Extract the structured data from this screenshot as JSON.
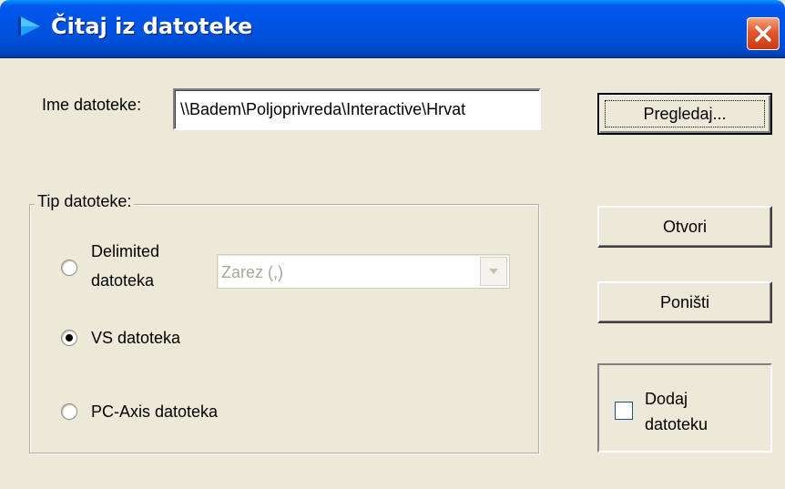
{
  "window": {
    "title": "Čitaj iz datoteke",
    "icon": "blue-pennant-icon",
    "close_icon": "close-icon"
  },
  "file_name": {
    "label": "Ime datoteke:",
    "value": "\\\\Badem\\Poljoprivreda\\Interactive\\Hrvat"
  },
  "buttons": {
    "browse": "Pregledaj...",
    "open": "Otvori",
    "cancel": "Poništi"
  },
  "file_type": {
    "group_title": "Tip datoteke:",
    "options": [
      {
        "label_line1": "Delimited",
        "label_line2": "datoteka",
        "checked": false
      },
      {
        "label": "VS datoteka",
        "checked": true
      },
      {
        "label": "PC-Axis datoteka",
        "checked": false
      }
    ],
    "delimiter_select": {
      "value": "Zarez (,)",
      "enabled": false
    }
  },
  "append": {
    "label_line1": "Dodaj",
    "label_line2": "datoteku",
    "checked": false
  },
  "colors": {
    "titlebar": "#0050d8",
    "dialog_bg": "#ece9d8",
    "close_button": "#e3562d",
    "disabled_text": "#a8a799"
  }
}
